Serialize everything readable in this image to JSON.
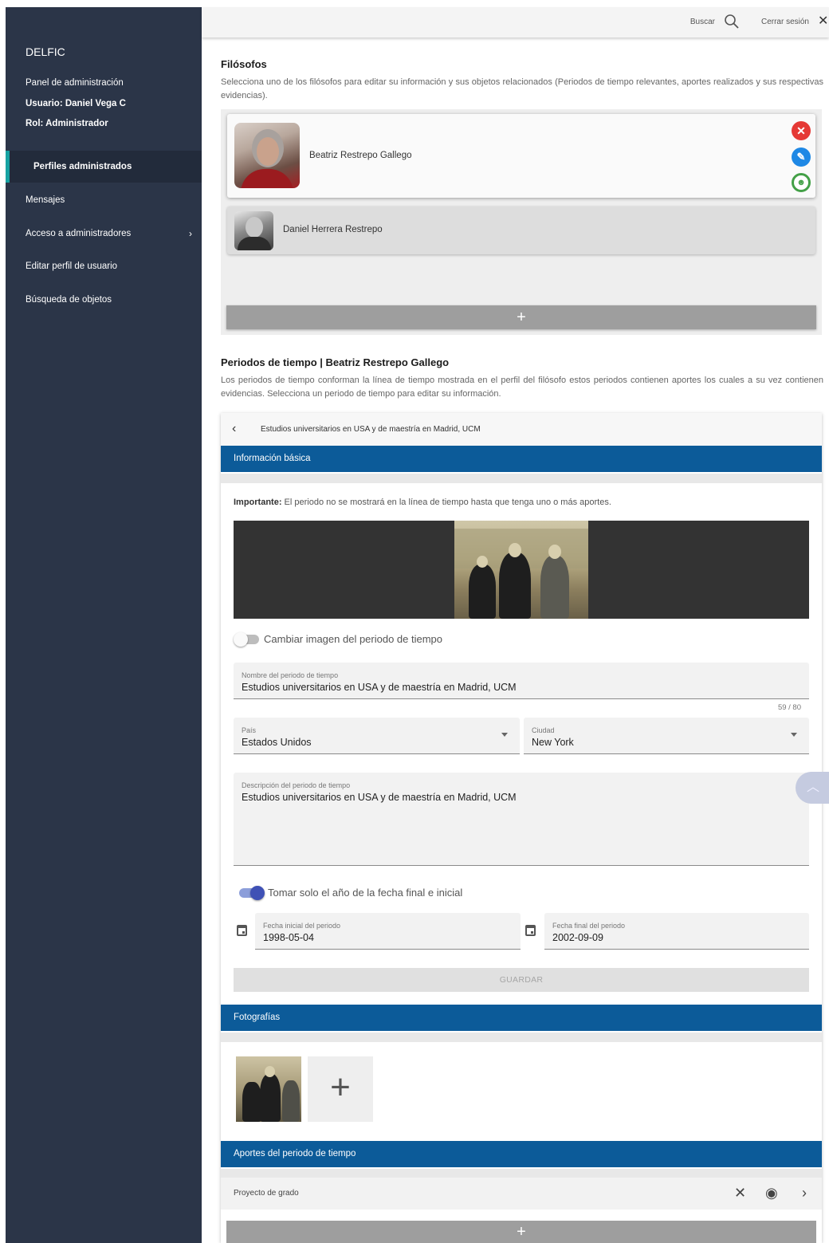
{
  "sidebar": {
    "brand": "DELFIC",
    "panel_label": "Panel de administración",
    "user_label": "Usuario: Daniel Vega C",
    "role_label": "Rol: Administrador",
    "items": [
      {
        "label": "Perfiles administrados",
        "active": true
      },
      {
        "label": "Mensajes"
      },
      {
        "label": "Acceso a administradores",
        "chevron": "›"
      },
      {
        "label": "Editar perfil de usuario"
      },
      {
        "label": "Búsqueda de objetos"
      }
    ]
  },
  "topbar": {
    "search_label": "Buscar",
    "logout_label": "Cerrar sesión",
    "close_glyph": "✕"
  },
  "philosophers": {
    "title": "Filósofos",
    "description": "Selecciona uno de los filósofos para editar su información y sus objetos relacionados (Periodos de tiempo relevantes, aportes realizados y sus respectivas evidencias).",
    "list": [
      {
        "name": "Beatriz Restrepo Gallego",
        "selected": true
      },
      {
        "name": "Daniel Herrera Restrepo",
        "selected": false
      }
    ],
    "actions": {
      "delete": "✕",
      "edit": "✎",
      "profile": "☻"
    },
    "add_glyph": "+"
  },
  "periods": {
    "title": "Periodos de tiempo | Beatriz Restrepo Gallego",
    "description": "Los periodos de tiempo conforman la línea de tiempo mostrada en el perfil del filósofo estos periodos contienen aportes los cuales a su vez contienen evidencias. Selecciona un periodo de tiempo para editar su información.",
    "panel": {
      "back_glyph": "‹",
      "header_title": "Estudios universitarios en USA y de maestría en Madrid, UCM",
      "basic_info_title": "Información básica",
      "important_label": "Importante:",
      "important_text": " El periodo no se mostrará en la línea de tiempo hasta que tenga uno o más aportes.",
      "change_image_label": "Cambiar imagen del periodo de tiempo",
      "change_image_on": false,
      "name_field": {
        "label": "Nombre del periodo de tiempo",
        "value": "Estudios universitarios en USA y de maestría en Madrid, UCM",
        "counter": "59 / 80"
      },
      "country_field": {
        "label": "País",
        "value": "Estados Unidos"
      },
      "city_field": {
        "label": "Ciudad",
        "value": "New York"
      },
      "description_field": {
        "label": "Descripción del periodo de tiempo",
        "value": "Estudios universitarios en USA y de maestría en Madrid, UCM"
      },
      "year_only_label": "Tomar solo el año de la fecha final e inicial",
      "year_only_on": true,
      "start_date": {
        "label": "Fecha inicial del periodo",
        "value": "1998-05-04"
      },
      "end_date": {
        "label": "Fecha final del periodo",
        "value": "2002-09-09"
      },
      "save_label": "GUARDAR",
      "photos_title": "Fotografías",
      "add_photo_glyph": "+",
      "aportes_title": "Aportes del periodo de tiempo",
      "aportes": [
        {
          "name": "Proyecto de grado"
        }
      ],
      "aporte_icons": {
        "remove": "✕",
        "view": "◉",
        "open": "›"
      },
      "add_aporte_glyph": "+"
    }
  },
  "scroll_top_glyph": "︿"
}
